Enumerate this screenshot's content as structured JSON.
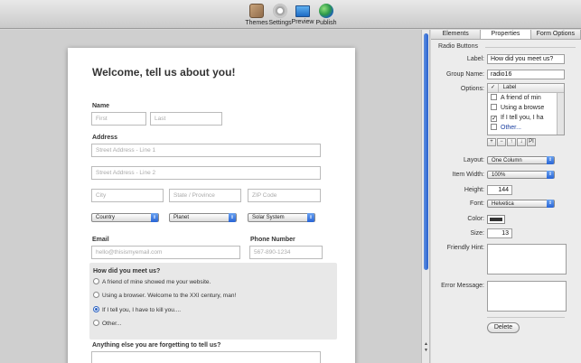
{
  "toolbar": {
    "themes": "Themes",
    "settings": "Settings",
    "preview": "Preview",
    "publish": "Publish"
  },
  "form": {
    "title": "Welcome, tell us about you!",
    "name_label": "Name",
    "first_placeholder": "First",
    "last_placeholder": "Last",
    "address_label": "Address",
    "street1_placeholder": "Street Address - Line 1",
    "street2_placeholder": "Street Address - Line 2",
    "city_placeholder": "City",
    "state_placeholder": "State / Province",
    "zip_placeholder": "ZIP Code",
    "country_select": "Country",
    "planet_select": "Planet",
    "solar_select": "Solar System",
    "email_label": "Email",
    "email_placeholder": "hello@thisismyemail.com",
    "phone_label": "Phone Number",
    "phone_placeholder": "567-890-1234",
    "radio_title": "How did you meet us?",
    "radio_options": [
      "A friend of mine showed me your website.",
      "Using a browser. Welcome to the XXI century, man!",
      "If I tell you, I have to kill you....",
      "Other..."
    ],
    "radio_selected_index": 2,
    "extra_label": "Anything else you are forgetting to tell us?"
  },
  "panel": {
    "tabs": [
      "Elements",
      "Properties",
      "Form Options"
    ],
    "active_tab": "Properties",
    "section_title": "Radio Buttons",
    "label_label": "Label:",
    "label_value": "How did you meet us?",
    "group_label": "Group Name:",
    "group_value": "radio16",
    "options_label": "Options:",
    "options_header": "Label",
    "options_header_check": "✓",
    "options_rows": [
      {
        "text": "A friend of min",
        "checked": false
      },
      {
        "text": "Using a browse",
        "checked": false
      },
      {
        "text": "If I tell you, I ha",
        "checked": true
      },
      {
        "text": "Other...",
        "checked": false
      }
    ],
    "option_buttons": [
      "+",
      "−",
      "↑",
      "↓",
      "PI"
    ],
    "layout_label": "Layout:",
    "layout_value": "One Column",
    "item_width_label": "Item Width:",
    "item_width_value": "100%",
    "height_label": "Height:",
    "height_value": "144",
    "font_label": "Font:",
    "font_value": "Helvetica",
    "color_label": "Color:",
    "color_value": "#333333",
    "size_label": "Size:",
    "size_value": "13",
    "friendly_hint_label": "Friendly Hint:",
    "error_message_label": "Error Message:",
    "delete_label": "Delete"
  },
  "colors": {
    "accent": "#2764d6"
  }
}
